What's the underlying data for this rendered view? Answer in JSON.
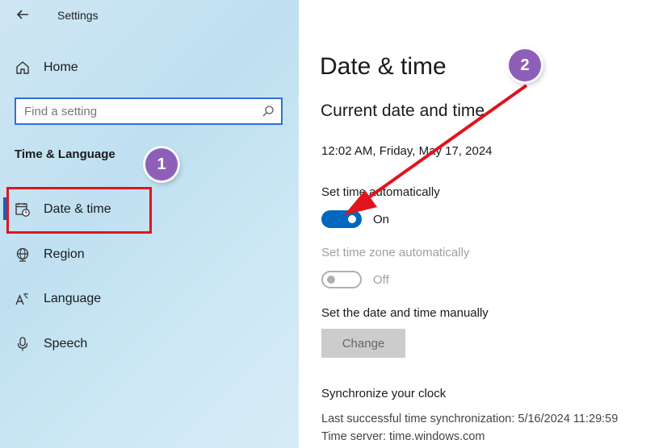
{
  "window": {
    "title": "Settings"
  },
  "sidebar": {
    "home_label": "Home",
    "search_placeholder": "Find a setting",
    "section_title": "Time & Language",
    "items": [
      {
        "label": "Date & time",
        "icon": "calendar-clock-icon",
        "selected": true
      },
      {
        "label": "Region",
        "icon": "globe-icon"
      },
      {
        "label": "Language",
        "icon": "language-icon"
      },
      {
        "label": "Speech",
        "icon": "microphone-icon"
      }
    ]
  },
  "main": {
    "title": "Date & time",
    "subtitle": "Current date and time",
    "current_datetime": "12:02 AM, Friday, May 17, 2024",
    "set_time_auto": {
      "label": "Set time automatically",
      "state": "On",
      "enabled": true
    },
    "set_timezone_auto": {
      "label": "Set time zone automatically",
      "state": "Off",
      "enabled": false
    },
    "manual": {
      "label": "Set the date and time manually",
      "button": "Change"
    },
    "sync": {
      "heading": "Synchronize your clock",
      "last_sync": "Last successful time synchronization: 5/16/2024 11:29:59",
      "server": "Time server: time.windows.com"
    }
  },
  "annotations": [
    {
      "number": "1"
    },
    {
      "number": "2"
    }
  ],
  "colors": {
    "accent": "#0067c0",
    "highlight_box": "#e0141e",
    "badge": "#8e5fb8",
    "arrow": "#e0141e"
  }
}
